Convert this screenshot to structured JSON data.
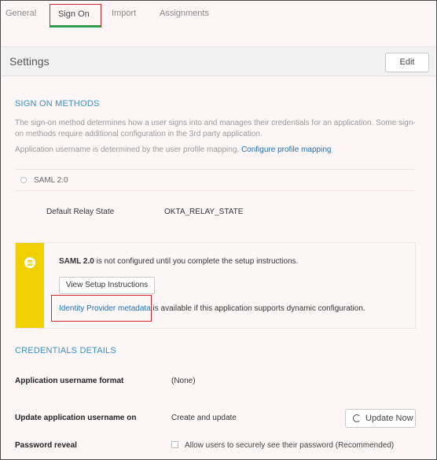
{
  "tabs": [
    {
      "label": "General"
    },
    {
      "label": "Sign On"
    },
    {
      "label": "Import"
    },
    {
      "label": "Assignments"
    }
  ],
  "settings": {
    "title": "Settings",
    "edit_label": "Edit"
  },
  "sign_on_methods": {
    "heading": "SIGN ON METHODS",
    "description_line1": "The sign-on method determines how a user signs into and manages their credentials for an application. Some sign-",
    "description_line2": "on methods require additional configuration in the 3rd party application.",
    "mapping_text": "Application username is determined by the user profile mapping.",
    "mapping_link": "Configure profile mapping",
    "saml_option": "SAML 2.0",
    "relay_state_label": "Default Relay State",
    "relay_state_value": "OKTA_RELAY_STATE"
  },
  "notice": {
    "bold": "SAML 2.0",
    "text": " is not configured until you complete the setup instructions.",
    "button_label": "View Setup Instructions",
    "idp_link": "Identity Provider metadata",
    "idp_text": " is available if this application supports dynamic configuration.",
    "bar_color": "#f0d000"
  },
  "credentials": {
    "heading": "CREDENTIALS DETAILS",
    "username_format_label": "Application username format",
    "username_format_value": "(None)",
    "update_on_label": "Update application username on",
    "update_on_value": "Create and update",
    "update_now_label": "Update Now",
    "password_reveal_label": "Password reveal",
    "password_reveal_checkbox": "Allow users to securely see their password (Recommended)"
  },
  "colors": {
    "accent_link": "#1c6fb4",
    "section_heading": "#3a8fc0",
    "active_tab_underline": "#2f9a4e",
    "highlight_box": "#d0242a"
  }
}
